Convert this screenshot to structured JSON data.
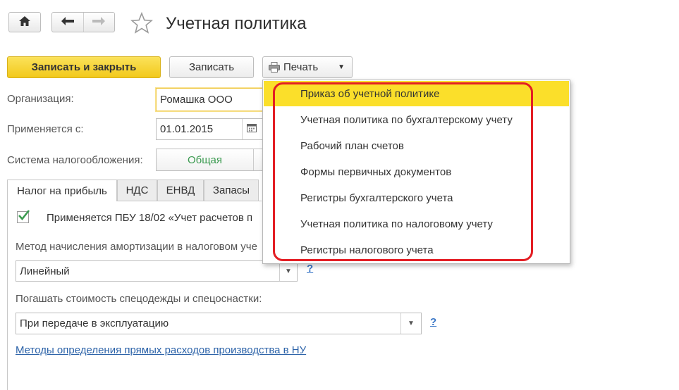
{
  "window": {
    "title": "Учетная политика"
  },
  "nav": {
    "home_icon": "home-icon",
    "back_icon": "arrow-left-icon",
    "forward_icon": "arrow-right-icon",
    "favorite_icon": "star-icon"
  },
  "toolbar": {
    "save_close_label": "Записать и закрыть",
    "save_label": "Записать",
    "print_label": "Печать"
  },
  "form": {
    "org_label": "Организация:",
    "org_value": "Ромашка ООО",
    "applies_label": "Применяется с:",
    "applies_value": "01.01.2015",
    "tax_system_label": "Система налогообложения:",
    "tax_system_value": "Общая"
  },
  "tabs": [
    {
      "label": "Налог на прибыль"
    },
    {
      "label": "НДС"
    },
    {
      "label": "ЕНВД"
    },
    {
      "label": "Запасы"
    }
  ],
  "tab_content": {
    "pbu_text": "Применяется ПБУ 18/02 «Учет расчетов п",
    "amort_label": "Метод начисления амортизации в налоговом уче",
    "amort_value": "Линейный",
    "workwear_label": "Погашать стоимость спецодежды и спецоснастки:",
    "workwear_value": "При передаче в эксплуатацию",
    "help_mark": "?",
    "direct_costs_link": "Методы определения прямых расходов производства в НУ"
  },
  "print_menu": {
    "items": [
      {
        "label": "Приказ об учетной политике"
      },
      {
        "label": "Учетная политика по бухгалтерскому учету"
      },
      {
        "label": "Рабочий план счетов"
      },
      {
        "label": "Формы первичных документов"
      },
      {
        "label": "Регистры бухгалтерского учета"
      },
      {
        "label": "Учетная политика по налоговому учету"
      },
      {
        "label": "Регистры налогового учета"
      }
    ]
  },
  "colors": {
    "accent_yellow": "#fbdf2a",
    "highlight_red": "#e31e24",
    "link_blue": "#2b62a8",
    "tax_green": "#3a9a4f"
  }
}
